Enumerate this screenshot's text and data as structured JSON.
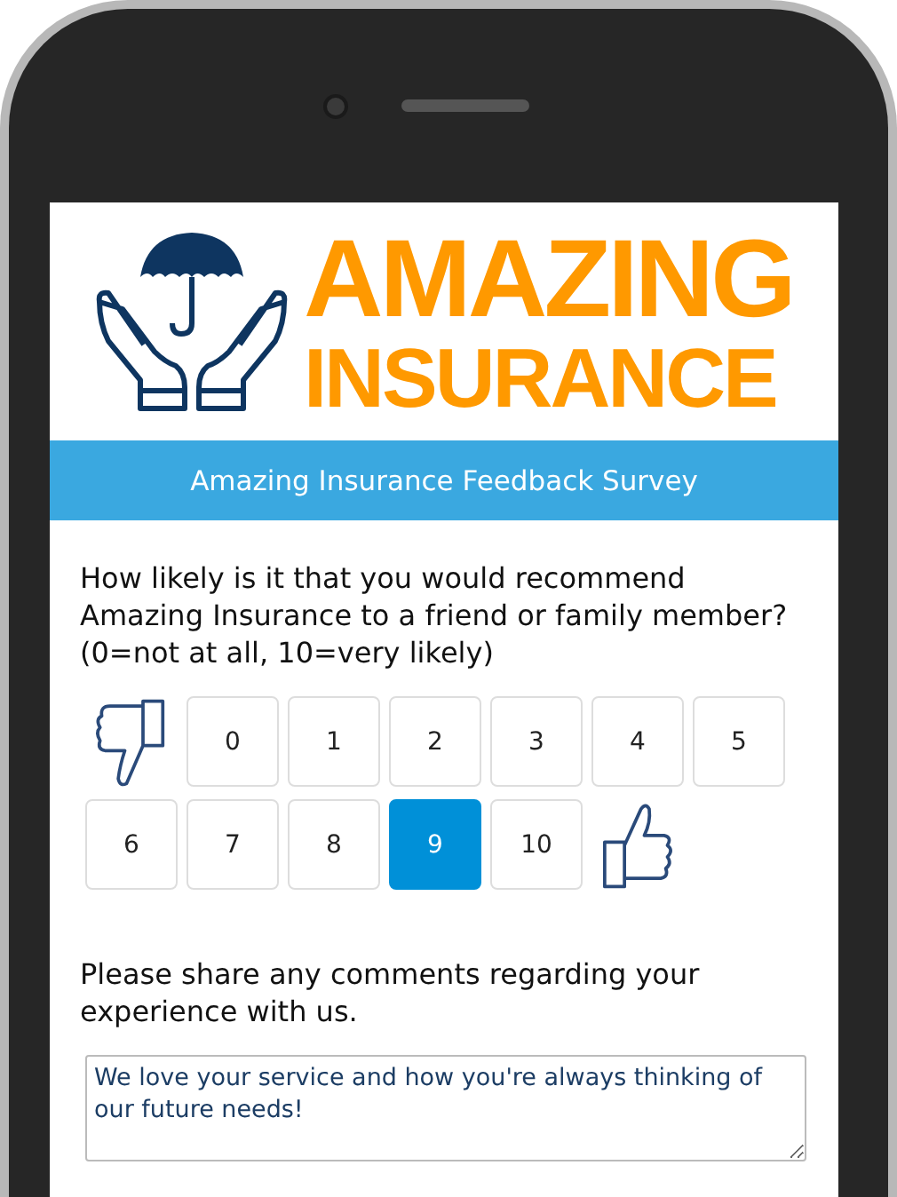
{
  "logo": {
    "line_1": "AMAZING",
    "line_2": "INSURANCE"
  },
  "header": {
    "title": "Amazing Insurance Feedback Survey"
  },
  "questions": [
    {
      "kind": "rating",
      "prompt": "How likely is it that you would recommend Amazing Insurance to a friend or family member? (0=not at all, 10=very likely)",
      "options": [
        {
          "label": "0",
          "selected": false
        },
        {
          "label": "1",
          "selected": false
        },
        {
          "label": "2",
          "selected": false
        },
        {
          "label": "3",
          "selected": false
        },
        {
          "label": "4",
          "selected": false
        },
        {
          "label": "5",
          "selected": false
        },
        {
          "label": "6",
          "selected": false
        },
        {
          "label": "7",
          "selected": false
        },
        {
          "label": "8",
          "selected": false
        },
        {
          "label": "9",
          "selected": true
        },
        {
          "label": "10",
          "selected": false
        }
      ]
    },
    {
      "kind": "comment",
      "prompt": "Please share any comments regarding your experience with us.",
      "value": "We love your service and how you're always thinking of our future needs!"
    }
  ]
}
